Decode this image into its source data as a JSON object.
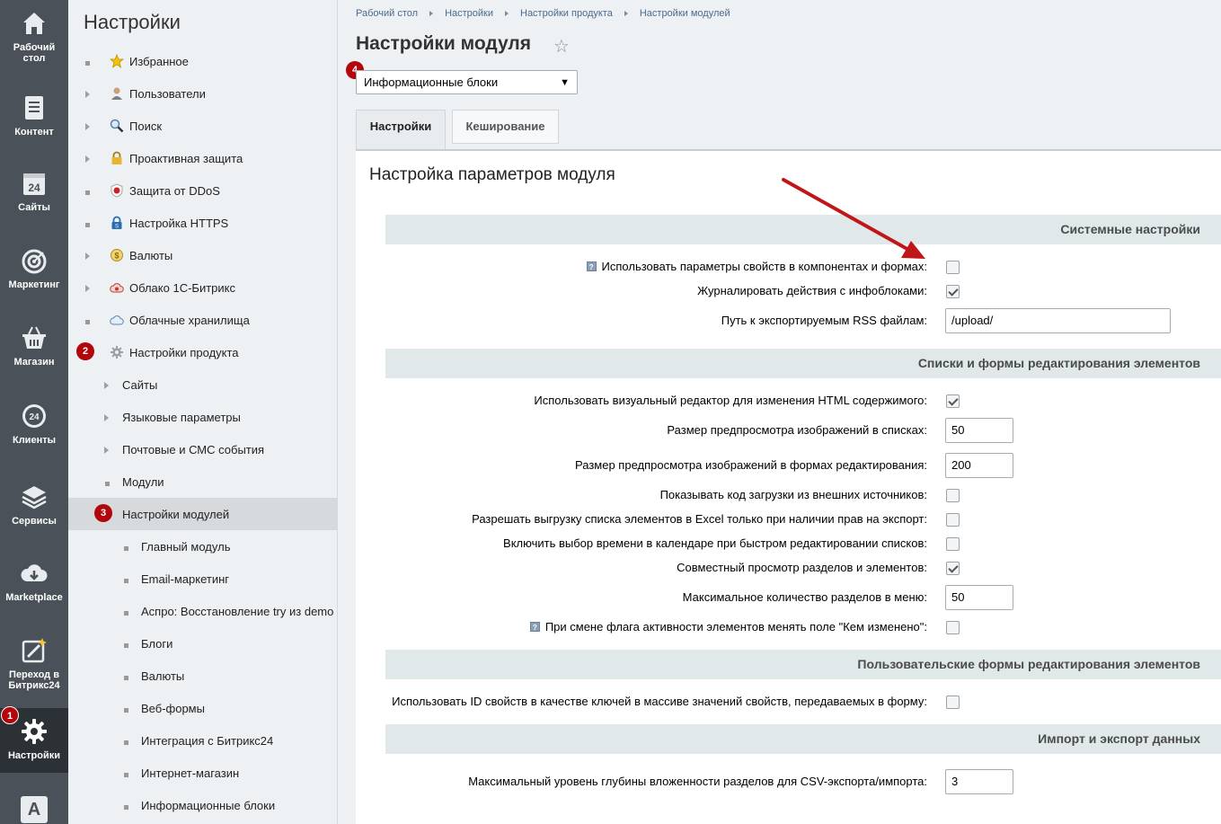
{
  "leftbar": {
    "items": [
      {
        "label_line1": "Рабочий",
        "label_line2": "стол",
        "icon": "home-icon"
      },
      {
        "label_line1": "Контент",
        "label_line2": "",
        "icon": "document-icon"
      },
      {
        "label_line1": "Сайты",
        "label_line2": "",
        "icon": "calendar-24-icon"
      },
      {
        "label_line1": "Маркетинг",
        "label_line2": "",
        "icon": "target-icon"
      },
      {
        "label_line1": "Магазин",
        "label_line2": "",
        "icon": "basket-icon"
      },
      {
        "label_line1": "Клиенты",
        "label_line2": "",
        "icon": "clients-24-icon"
      },
      {
        "label_line1": "Сервисы",
        "label_line2": "",
        "icon": "layers-icon"
      },
      {
        "label_line1": "Marketplace",
        "label_line2": "",
        "icon": "cloud-download-icon"
      },
      {
        "label_line1": "Переход в",
        "label_line2": "Битрикс24",
        "icon": "magic-wand-icon"
      },
      {
        "label_line1": "Настройки",
        "label_line2": "",
        "icon": "gear-icon"
      },
      {
        "label_line1": "",
        "label_line2": "",
        "icon": "letter-a-icon"
      }
    ],
    "badge_1": "1",
    "logo_letter": "A"
  },
  "menu2": {
    "title": "Настройки",
    "items": [
      {
        "label": "Избранное",
        "icon": "star-icon"
      },
      {
        "label": "Пользователи",
        "icon": "user-icon"
      },
      {
        "label": "Поиск",
        "icon": "search-icon"
      },
      {
        "label": "Проактивная защита",
        "icon": "lock-icon"
      },
      {
        "label": "Защита от DDoS",
        "icon": "shield-icon"
      },
      {
        "label": "Настройка HTTPS",
        "icon": "https-lock-icon"
      },
      {
        "label": "Валюты",
        "icon": "coin-icon"
      },
      {
        "label": "Облако 1С-Битрикс",
        "icon": "cloud-icon"
      },
      {
        "label": "Облачные хранилища",
        "icon": "cloud-storage-icon"
      },
      {
        "label": "Настройки продукта",
        "icon": "settings-gear-icon"
      },
      {
        "label": "Сайты"
      },
      {
        "label": "Языковые параметры"
      },
      {
        "label": "Почтовые и СМС события"
      },
      {
        "label": "Модули"
      },
      {
        "label": "Настройки модулей"
      },
      {
        "label": "Главный модуль"
      },
      {
        "label": "Email-маркетинг"
      },
      {
        "label": "Аспро: Восстановление try из demo"
      },
      {
        "label": "Блоги"
      },
      {
        "label": "Валюты"
      },
      {
        "label": "Веб-формы"
      },
      {
        "label": "Интеграция с Битрикс24"
      },
      {
        "label": "Интернет-магазин"
      },
      {
        "label": "Информационные блоки"
      }
    ],
    "badge_2": "2",
    "badge_3": "3"
  },
  "breadcrumb": [
    "Рабочий стол",
    "Настройки",
    "Настройки продукта",
    "Настройки модулей"
  ],
  "page": {
    "title": "Настройки модуля",
    "badge_4": "4",
    "module_select": "Информационные блоки"
  },
  "tabs": [
    {
      "label": "Настройки"
    },
    {
      "label": "Кеширование"
    }
  ],
  "panel": {
    "title": "Настройка параметров модуля",
    "sections": [
      {
        "title": "Системные настройки"
      },
      {
        "title": "Списки и формы редактирования элементов"
      },
      {
        "title": "Пользовательские формы редактирования элементов"
      },
      {
        "title": "Импорт и экспорт данных"
      }
    ],
    "options": [
      {
        "label": "Использовать параметры свойств в компонентах и формах:",
        "type": "checkbox",
        "checked": false,
        "help": true
      },
      {
        "label": "Журналировать действия с инфоблоками:",
        "type": "checkbox",
        "checked": true
      },
      {
        "label": "Путь к экспортируемым RSS файлам:",
        "type": "text",
        "value": "/upload/"
      },
      {
        "label": "Использовать визуальный редактор для изменения HTML содержимого:",
        "type": "checkbox",
        "checked": true
      },
      {
        "label": "Размер предпросмотра изображений в списках:",
        "type": "text",
        "value": "50"
      },
      {
        "label": "Размер предпросмотра изображений в формах редактирования:",
        "type": "text",
        "value": "200"
      },
      {
        "label": "Показывать код загрузки из внешних источников:",
        "type": "checkbox",
        "checked": false
      },
      {
        "label": "Разрешать выгрузку списка элементов в Excel только при наличии прав на экспорт:",
        "type": "checkbox",
        "checked": false
      },
      {
        "label": "Включить выбор времени в календаре при быстром редактировании списков:",
        "type": "checkbox",
        "checked": false
      },
      {
        "label": "Совместный просмотр разделов и элементов:",
        "type": "checkbox",
        "checked": true
      },
      {
        "label": "Максимальное количество разделов в меню:",
        "type": "text",
        "value": "50"
      },
      {
        "label": "При смене флага активности элементов менять поле \"Кем изменено\":",
        "type": "checkbox",
        "checked": false,
        "help": true
      },
      {
        "label": "Использовать ID свойств в качестве ключей в массиве значений свойств, передаваемых в форму:",
        "type": "checkbox",
        "checked": false
      },
      {
        "label": "Максимальный уровень глубины вложенности разделов для CSV-экспорта/импорта:",
        "type": "text",
        "value": "3"
      }
    ],
    "help_mark": "?"
  },
  "colors": {
    "badge": "#b3060c",
    "arrow": "#c0161a",
    "leftbar": "#4a5158",
    "section_bg": "#e0e8ea"
  }
}
